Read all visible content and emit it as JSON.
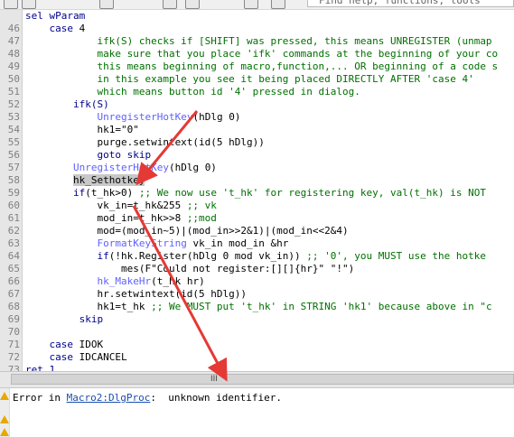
{
  "toolbar": {
    "search_placeholder": "Find help, functions, tools"
  },
  "editor": {
    "lines": [
      {
        "n": "",
        "parts": [
          {
            "t": "sel wParam",
            "c": "blue"
          }
        ]
      },
      {
        "n": "46",
        "parts": [
          {
            "t": "    case ",
            "c": "blue"
          },
          {
            "t": "4",
            "c": ""
          }
        ]
      },
      {
        "n": "47",
        "parts": [
          {
            "t": "            ifk(S) checks if [SHIFT] was pressed, this means UNREGISTER (unmap",
            "c": "cmt"
          }
        ]
      },
      {
        "n": "48",
        "parts": [
          {
            "t": "            make sure that you place 'ifk' commands at the beginning of your co",
            "c": "cmt"
          }
        ]
      },
      {
        "n": "49",
        "parts": [
          {
            "t": "            this means beginning of macro,function,... OR beginning of a code s",
            "c": "cmt"
          }
        ]
      },
      {
        "n": "50",
        "parts": [
          {
            "t": "            in this example you see it being placed DIRECTLY AFTER 'case 4'",
            "c": "cmt"
          }
        ]
      },
      {
        "n": "51",
        "parts": [
          {
            "t": "            which means button id '4' pressed in dialog.",
            "c": "cmt"
          }
        ]
      },
      {
        "n": "52",
        "parts": [
          {
            "t": "        ifk(S)",
            "c": "blue"
          }
        ]
      },
      {
        "n": "53",
        "parts": [
          {
            "t": "            ",
            "c": ""
          },
          {
            "t": "UnregisterHotKey",
            "c": "fn"
          },
          {
            "t": "(hDlg 0)",
            "c": ""
          }
        ]
      },
      {
        "n": "54",
        "parts": [
          {
            "t": "            hk1=\"0\"",
            "c": ""
          }
        ]
      },
      {
        "n": "55",
        "parts": [
          {
            "t": "            purge.setwintext(id(5 hDlg))",
            "c": ""
          }
        ]
      },
      {
        "n": "56",
        "parts": [
          {
            "t": "            goto skip",
            "c": "blue"
          }
        ]
      },
      {
        "n": "57",
        "parts": [
          {
            "t": "        ",
            "c": ""
          },
          {
            "t": "UnregisterHotKey",
            "c": "fn"
          },
          {
            "t": "(hDlg 0)",
            "c": ""
          }
        ]
      },
      {
        "n": "58",
        "parts": [
          {
            "t": "        ",
            "c": ""
          },
          {
            "t": "hk_Sethotkey",
            "c": "sel"
          }
        ]
      },
      {
        "n": "59",
        "parts": [
          {
            "t": "        ",
            "c": ""
          },
          {
            "t": "if",
            "c": "blue"
          },
          {
            "t": "(t_hk>0) ",
            "c": ""
          },
          {
            "t": ";; We now use 't_hk' for registering key, val(t_hk) is NOT",
            "c": "cmt"
          }
        ]
      },
      {
        "n": "60",
        "parts": [
          {
            "t": "            vk_in=t_hk&255 ",
            "c": ""
          },
          {
            "t": ";; vk",
            "c": "cmt"
          }
        ]
      },
      {
        "n": "61",
        "parts": [
          {
            "t": "            mod_in=t_hk>>8 ",
            "c": ""
          },
          {
            "t": ";;mod",
            "c": "cmt"
          }
        ]
      },
      {
        "n": "62",
        "parts": [
          {
            "t": "            mod=(mod_in~5)|(mod_in>>2&1)|(mod_in<<2&4)",
            "c": ""
          }
        ]
      },
      {
        "n": "63",
        "parts": [
          {
            "t": "            ",
            "c": ""
          },
          {
            "t": "FormatKeyString",
            "c": "fn"
          },
          {
            "t": " vk_in mod_in &hr",
            "c": ""
          }
        ]
      },
      {
        "n": "64",
        "parts": [
          {
            "t": "            ",
            "c": ""
          },
          {
            "t": "if",
            "c": "blue"
          },
          {
            "t": "(!hk.Register(hDlg 0 mod vk_in)) ",
            "c": ""
          },
          {
            "t": ";; '0', you MUST use the hotke",
            "c": "cmt"
          }
        ]
      },
      {
        "n": "65",
        "parts": [
          {
            "t": "                mes(F\"Could not register:[][]{hr}\" \"!\")",
            "c": ""
          }
        ]
      },
      {
        "n": "66",
        "parts": [
          {
            "t": "            ",
            "c": ""
          },
          {
            "t": "hk_MakeHr",
            "c": "fn"
          },
          {
            "t": "(t_hk hr)",
            "c": ""
          }
        ]
      },
      {
        "n": "67",
        "parts": [
          {
            "t": "            hr.setwintext(id(5 hDlg))",
            "c": ""
          }
        ]
      },
      {
        "n": "68",
        "parts": [
          {
            "t": "            hk1=t_hk ",
            "c": ""
          },
          {
            "t": ";; We MUST put 't_hk' in STRING 'hk1' because above in \"c",
            "c": "cmt"
          }
        ]
      },
      {
        "n": "69",
        "parts": [
          {
            "t": "         skip",
            "c": "blue"
          }
        ]
      },
      {
        "n": "70",
        "parts": [
          {
            "t": "",
            "c": ""
          }
        ]
      },
      {
        "n": "71",
        "parts": [
          {
            "t": "    case ",
            "c": "blue"
          },
          {
            "t": "IDOK",
            "c": ""
          }
        ]
      },
      {
        "n": "72",
        "parts": [
          {
            "t": "    case ",
            "c": "blue"
          },
          {
            "t": "IDCANCEL",
            "c": ""
          }
        ]
      },
      {
        "n": "73",
        "parts": [
          {
            "t": "ret 1",
            "c": "blue"
          }
        ]
      }
    ]
  },
  "output": {
    "prefix": "Error in ",
    "link": "Macro2:DlgProc",
    "suffix": ":  unknown identifier."
  },
  "scrollbar": {
    "grip": "III"
  },
  "colors": {
    "annotation_arrow": "#e53935"
  }
}
